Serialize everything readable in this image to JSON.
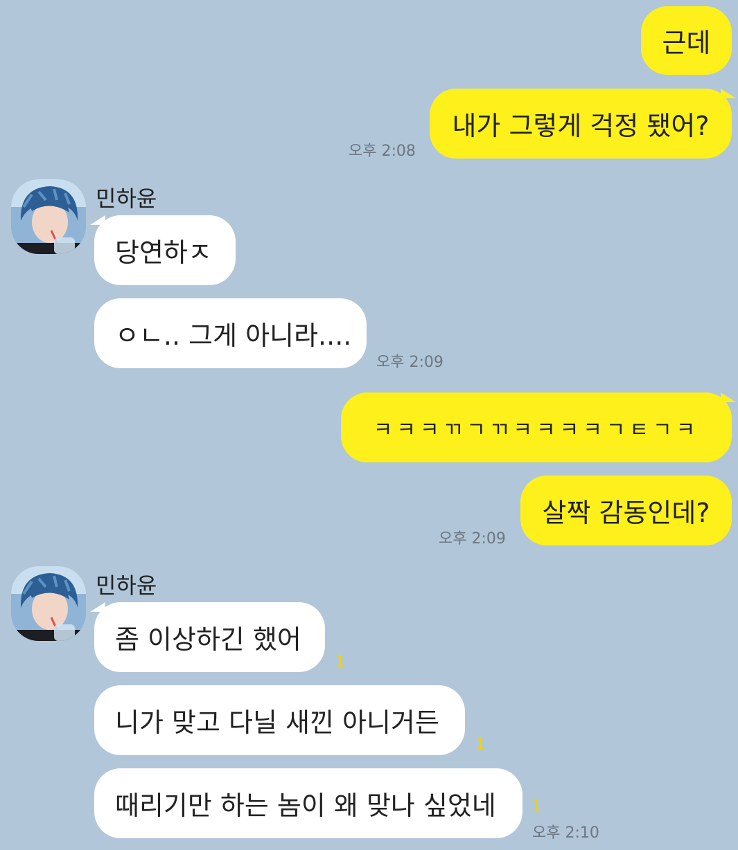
{
  "sender_name": "민하윤",
  "messages": {
    "m1": "근데",
    "m2": "내가 그렇게 걱정 됐어?",
    "m3": "당연하ㅈ",
    "m4": "ㅇㄴ.. 그게 아니라....",
    "m5": "ㅋㅋㅋㄲㄱㄲㅋㅋㅋㅋㄱㅌㄱㅋ",
    "m6": "살짝 감동인데?",
    "m7": "좀 이상하긴 했어",
    "m8": "니가 맞고 다닐 새낀 아니거든",
    "m9": "때리기만 하는 놈이 왜 맞나 싶었네"
  },
  "times": {
    "t1": "오후 2:08",
    "t2": "오후 2:09",
    "t3": "오후 2:09",
    "t4": "오후 2:10"
  },
  "unread": {
    "u1": "1",
    "u2": "1",
    "u3": "1"
  },
  "colors": {
    "background": "#b1c6d9",
    "my_bubble": "#fef01b",
    "their_bubble": "#ffffff",
    "unread_count": "#f0d400"
  }
}
